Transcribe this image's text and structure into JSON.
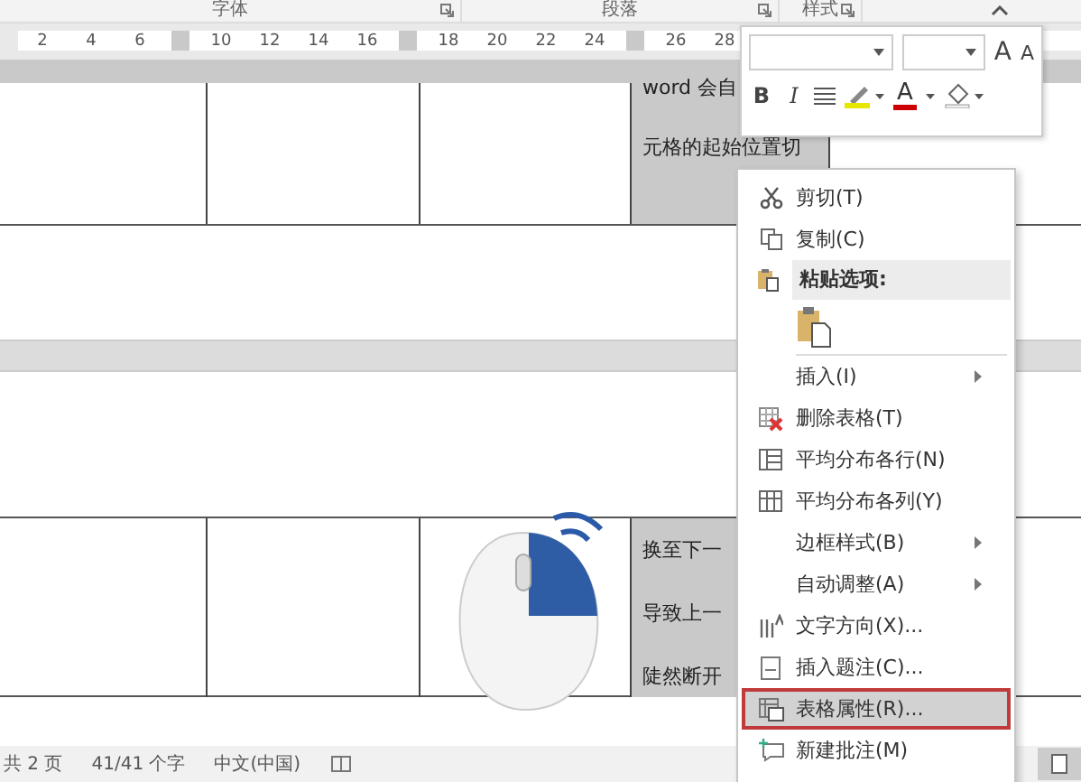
{
  "ribbon_groups": [
    "字体",
    "段落",
    "样式"
  ],
  "ruler": [
    [
      "2",
      "4",
      "6"
    ],
    [
      "10",
      "12",
      "14",
      "16"
    ],
    [
      "18",
      "20",
      "22",
      "24"
    ],
    [
      "26",
      "28"
    ]
  ],
  "table_top": {
    "cells": [
      "word 会自",
      "元格的起始位置切"
    ]
  },
  "table_bottom": {
    "cells": [
      "换至下一",
      "导致上一",
      "陡然断开"
    ]
  },
  "mini_toolbar": {
    "grow_font": "A",
    "shrink_font": "A",
    "bold": "B",
    "italic": "I",
    "font_color": "A"
  },
  "context_menu": [
    {
      "kind": "item",
      "label": "剪切(T)",
      "submenu": false,
      "selected": false
    },
    {
      "kind": "item",
      "label": "复制(C)",
      "submenu": false,
      "selected": false
    },
    {
      "kind": "header",
      "label": "粘贴选项:"
    },
    {
      "kind": "paste"
    },
    {
      "kind": "item",
      "label": "插入(I)",
      "submenu": true,
      "selected": false
    },
    {
      "kind": "item",
      "label": "删除表格(T)",
      "submenu": false,
      "selected": false
    },
    {
      "kind": "item",
      "label": "平均分布各行(N)",
      "submenu": false,
      "selected": false
    },
    {
      "kind": "item",
      "label": "平均分布各列(Y)",
      "submenu": false,
      "selected": false
    },
    {
      "kind": "item",
      "label": "边框样式(B)",
      "submenu": true,
      "selected": false
    },
    {
      "kind": "item",
      "label": "自动调整(A)",
      "submenu": true,
      "selected": false
    },
    {
      "kind": "item",
      "label": "文字方向(X)...",
      "submenu": false,
      "selected": false
    },
    {
      "kind": "item",
      "label": "插入题注(C)...",
      "submenu": false,
      "selected": false
    },
    {
      "kind": "item",
      "label": "表格属性(R)...",
      "submenu": false,
      "selected": true
    },
    {
      "kind": "item",
      "label": "新建批注(M)",
      "submenu": false,
      "selected": false
    }
  ],
  "status_bar": [
    "共 2 页",
    "41/41 个字",
    "中文(中国)"
  ]
}
